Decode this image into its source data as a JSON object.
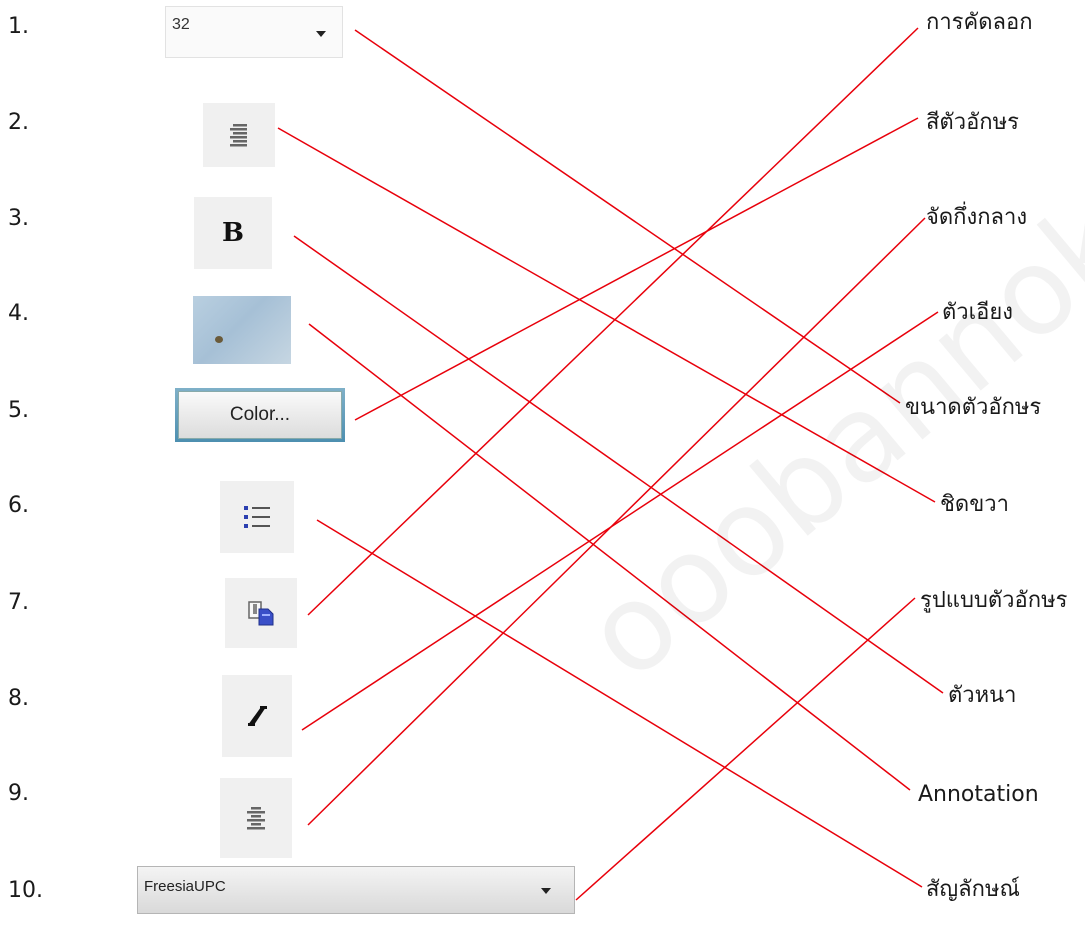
{
  "numbers": [
    "1.",
    "2.",
    "3.",
    "4.",
    "5.",
    "6.",
    "7.",
    "8.",
    "9.",
    "10."
  ],
  "icons": {
    "font_size_value": "32",
    "color_button_label": "Color...",
    "font_name_value": "FreesiaUPC"
  },
  "words": [
    "การคัดลอก",
    "สีตัวอักษร",
    "จัดกึ่งกลาง",
    "ตัวเอียง",
    "ขนาดตัวอักษร",
    "ชิดขวา",
    "รูปแบบตัวอักษร",
    "ตัวหนา",
    "Annotation",
    "สัญลักษณ์"
  ],
  "matches": [
    {
      "item": "1.",
      "word": "ขนาดตัวอักษร"
    },
    {
      "item": "2.",
      "word": "ชิดขวา"
    },
    {
      "item": "3.",
      "word": "ตัวหนา"
    },
    {
      "item": "4.",
      "word": "Annotation"
    },
    {
      "item": "5.",
      "word": "สีตัวอักษร"
    },
    {
      "item": "6.",
      "word": "สัญลักษณ์"
    },
    {
      "item": "7.",
      "word": "การคัดลอก"
    },
    {
      "item": "8.",
      "word": "ตัวเอียง"
    },
    {
      "item": "9.",
      "word": "จัดกึ่งกลาง"
    },
    {
      "item": "10.",
      "word": "รูปแบบตัวอักษร"
    }
  ],
  "colors": {
    "line": "#e8000b",
    "icon_bg": "#f0f0f0"
  },
  "watermark": "ooobannok"
}
